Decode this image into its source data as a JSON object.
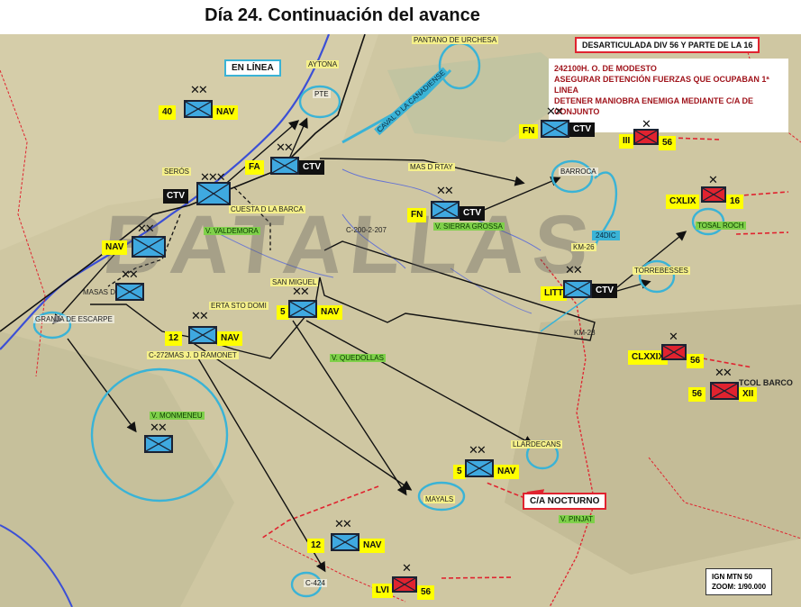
{
  "title": "Día 24. Continuación del avance",
  "header_boxes": {
    "desarticulada": "DESARTICULADA DIV 56 Y PARTE DE LA 16",
    "en_linea": "EN LÍNEA",
    "ca_nocturno": "C/A NOCTURNO"
  },
  "info": {
    "line1": "242100H.  O. DE MODESTO",
    "line2": "ASEGURAR DETENCIÓN FUERZAS QUE OCUPABAN 1ª LINEA",
    "line3": "DETENER MANIOBRA ENEMIGA MEDIANTE C/A DE CONJUNTO"
  },
  "map_scale": {
    "source": "IGN MTN 50",
    "zoom": "ZOOM: 1/90.000"
  },
  "watermark": "BATALLAS",
  "place_labels": {
    "aytona": "AYTONA",
    "pantano": "PANTANO DE URCHESA",
    "canal": "CAVAL D LA CANADIENSE",
    "pte": "PTE",
    "seros": "SERÓS",
    "cuesta": "CUESTA D LA BARCA",
    "valdemora": "V. VALDEMORA",
    "mas_rtay": "MAS D RTAY",
    "sierra_grossa": "V. SIERRA GROSSA",
    "barroca": "BARROCA",
    "d24": "24DIC",
    "c200": "C-200-2-207",
    "san_miguel": "SAN MIGUEL",
    "km26": "KM-26",
    "tosal_roch": "TOSAL ROCH",
    "torrebesses": "TORREBESSES",
    "masas": "MASAS D CAÑAS",
    "granja": "GRANJA DE ESCARPE",
    "erta": "ERTA STO DOMI",
    "km28": "KM-28",
    "c272": "C-272MAS J. D RAMONET",
    "quedollas": "V. QUEDOLLAS",
    "tcol_barco": "TCOL BARCO",
    "monmeneu": "V. MONMENEU",
    "llardecans": "LLARDECANS",
    "mayals": "MAYALS",
    "pinjat": "V. PINJAT",
    "c424": "C-424"
  },
  "units": {
    "u40": {
      "num": "40",
      "corps": "NAV",
      "echelon": "✕✕"
    },
    "fn1": {
      "num": "FN",
      "corps": "CTV",
      "echelon": "✕✕"
    },
    "iii56": {
      "num": "III",
      "corps": "56",
      "echelon": "✕"
    },
    "fa": {
      "num": "FA",
      "corps": "CTV",
      "echelon": "✕✕"
    },
    "ctv": {
      "num": "CTV",
      "echelon": "✕✕✕"
    },
    "fn2": {
      "num": "FN",
      "corps": "CTV",
      "echelon": "✕✕"
    },
    "cxlix": {
      "num": "CXLIX",
      "corps": "16",
      "echelon": "✕"
    },
    "nav": {
      "num": "NAV",
      "echelon": "✕✕"
    },
    "masas_unit": {
      "echelon": "✕✕"
    },
    "litt": {
      "num": "LITT",
      "corps": "CTV",
      "echelon": "✕✕"
    },
    "u5a": {
      "num": "5",
      "corps": "NAV",
      "echelon": "✕✕"
    },
    "u12a": {
      "num": "12",
      "corps": "NAV",
      "echelon": "✕✕"
    },
    "clxxix": {
      "num": "CLXXIX",
      "corps": "56",
      "echelon": "✕"
    },
    "u56xii": {
      "num": "56",
      "corps": "XII",
      "echelon": "✕✕"
    },
    "monmeneu_unit": {
      "echelon": "✕✕"
    },
    "u5b": {
      "num": "5",
      "corps": "NAV",
      "echelon": "✕✕"
    },
    "u12b": {
      "num": "12",
      "corps": "NAV",
      "echelon": "✕✕"
    },
    "lvi": {
      "num": "LVI",
      "corps": "56",
      "echelon": "✕"
    }
  },
  "colors": {
    "nationalist": "#3fa9e0",
    "republican": "#e0232f",
    "highlight": "#ffff00",
    "ring": "#3ab3d6",
    "river": "#3b4fd6"
  }
}
